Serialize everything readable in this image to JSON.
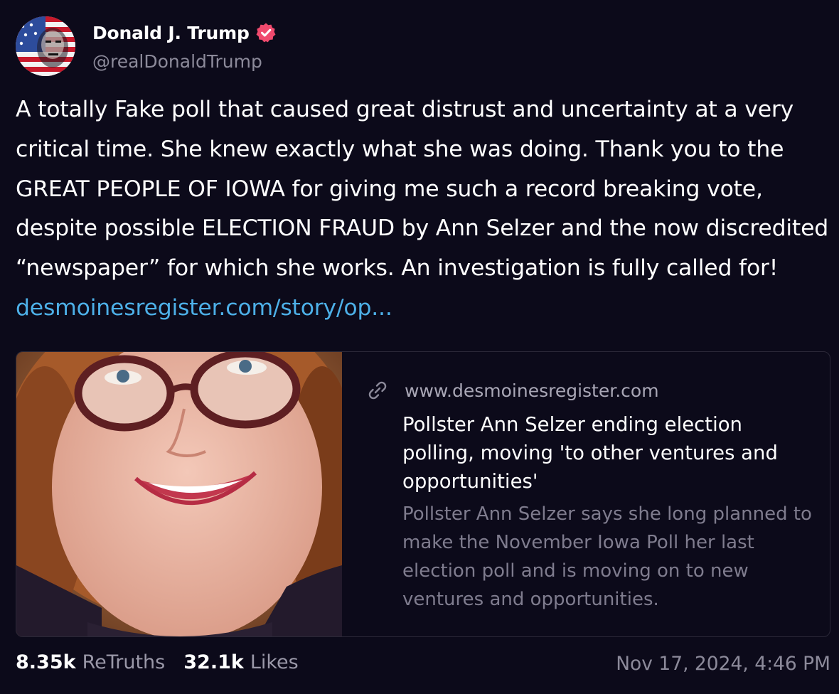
{
  "author": {
    "display_name": "Donald J. Trump",
    "handle": "@realDonaldTrump",
    "verified": true,
    "verified_color": "#f04a6e"
  },
  "post": {
    "text": "A totally Fake poll that caused great distrust and uncertainty at a very critical time. She knew exactly what she was doing. Thank you to the GREAT PEOPLE OF IOWA for giving me such a record breaking vote, despite possible ELECTION FRAUD by Ann Selzer and the now discredited “newspaper” for which she works. An investigation is fully called for!",
    "link_text": "desmoinesregister.com/story/op..."
  },
  "link_card": {
    "domain": "www.desmoinesregister.com",
    "title": "Pollster Ann Selzer ending election polling, moving 'to other ventures and opportunities'",
    "description": "Pollster Ann Selzer says she long planned to make the November Iowa Poll her last election poll and is moving on to new ventures and opportunities."
  },
  "stats": {
    "retruths_count": "8.35k",
    "retruths_label": "ReTruths",
    "likes_count": "32.1k",
    "likes_label": "Likes"
  },
  "timestamp": "Nov 17, 2024, 4:46 PM",
  "colors": {
    "background": "#0c0a1a",
    "link": "#4db0e8",
    "muted": "#8c8a9a"
  }
}
